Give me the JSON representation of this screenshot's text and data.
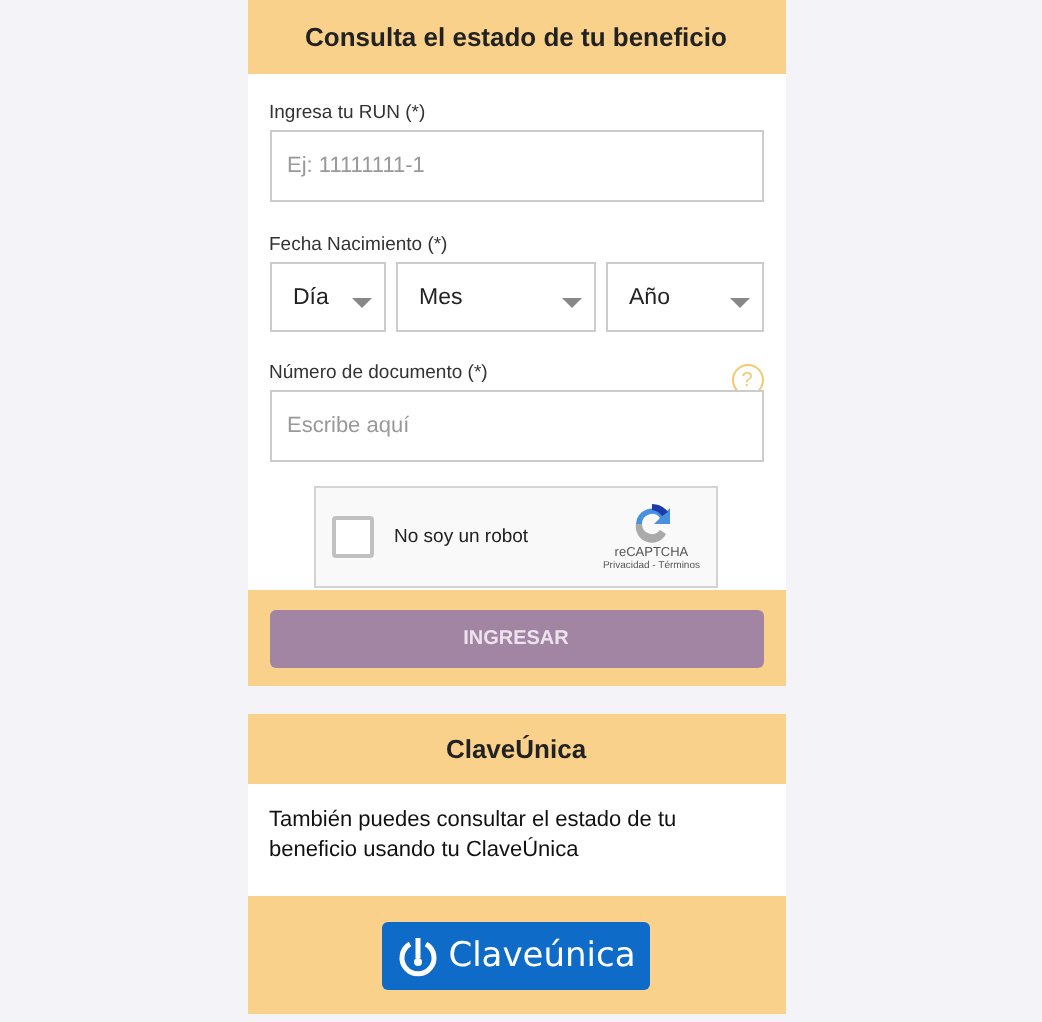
{
  "form": {
    "title": "Consulta el estado de tu beneficio",
    "run": {
      "label": "Ingresa tu RUN",
      "required": "(*)",
      "placeholder": "Ej: 11111111-1"
    },
    "birth": {
      "label": "Fecha Nacimiento",
      "required": "(*)",
      "selects": [
        {
          "value": "Día"
        },
        {
          "value": "Mes"
        },
        {
          "value": "Año"
        }
      ]
    },
    "document": {
      "label": "Número de documento",
      "required": "(*)",
      "placeholder": "Escribe aquí",
      "help": "?"
    },
    "captcha": {
      "label": "No soy un robot",
      "checked": false,
      "brand": "reCAPTCHA",
      "links": "Privacidad - Términos"
    },
    "submit": {
      "label": "INGRESAR",
      "disabled": true
    }
  },
  "clave": {
    "title": "ClaveÚnica",
    "text": "También puedes consultar el estado de tu beneficio usando tu ClaveÚnica",
    "button": "Claveúnica"
  }
}
